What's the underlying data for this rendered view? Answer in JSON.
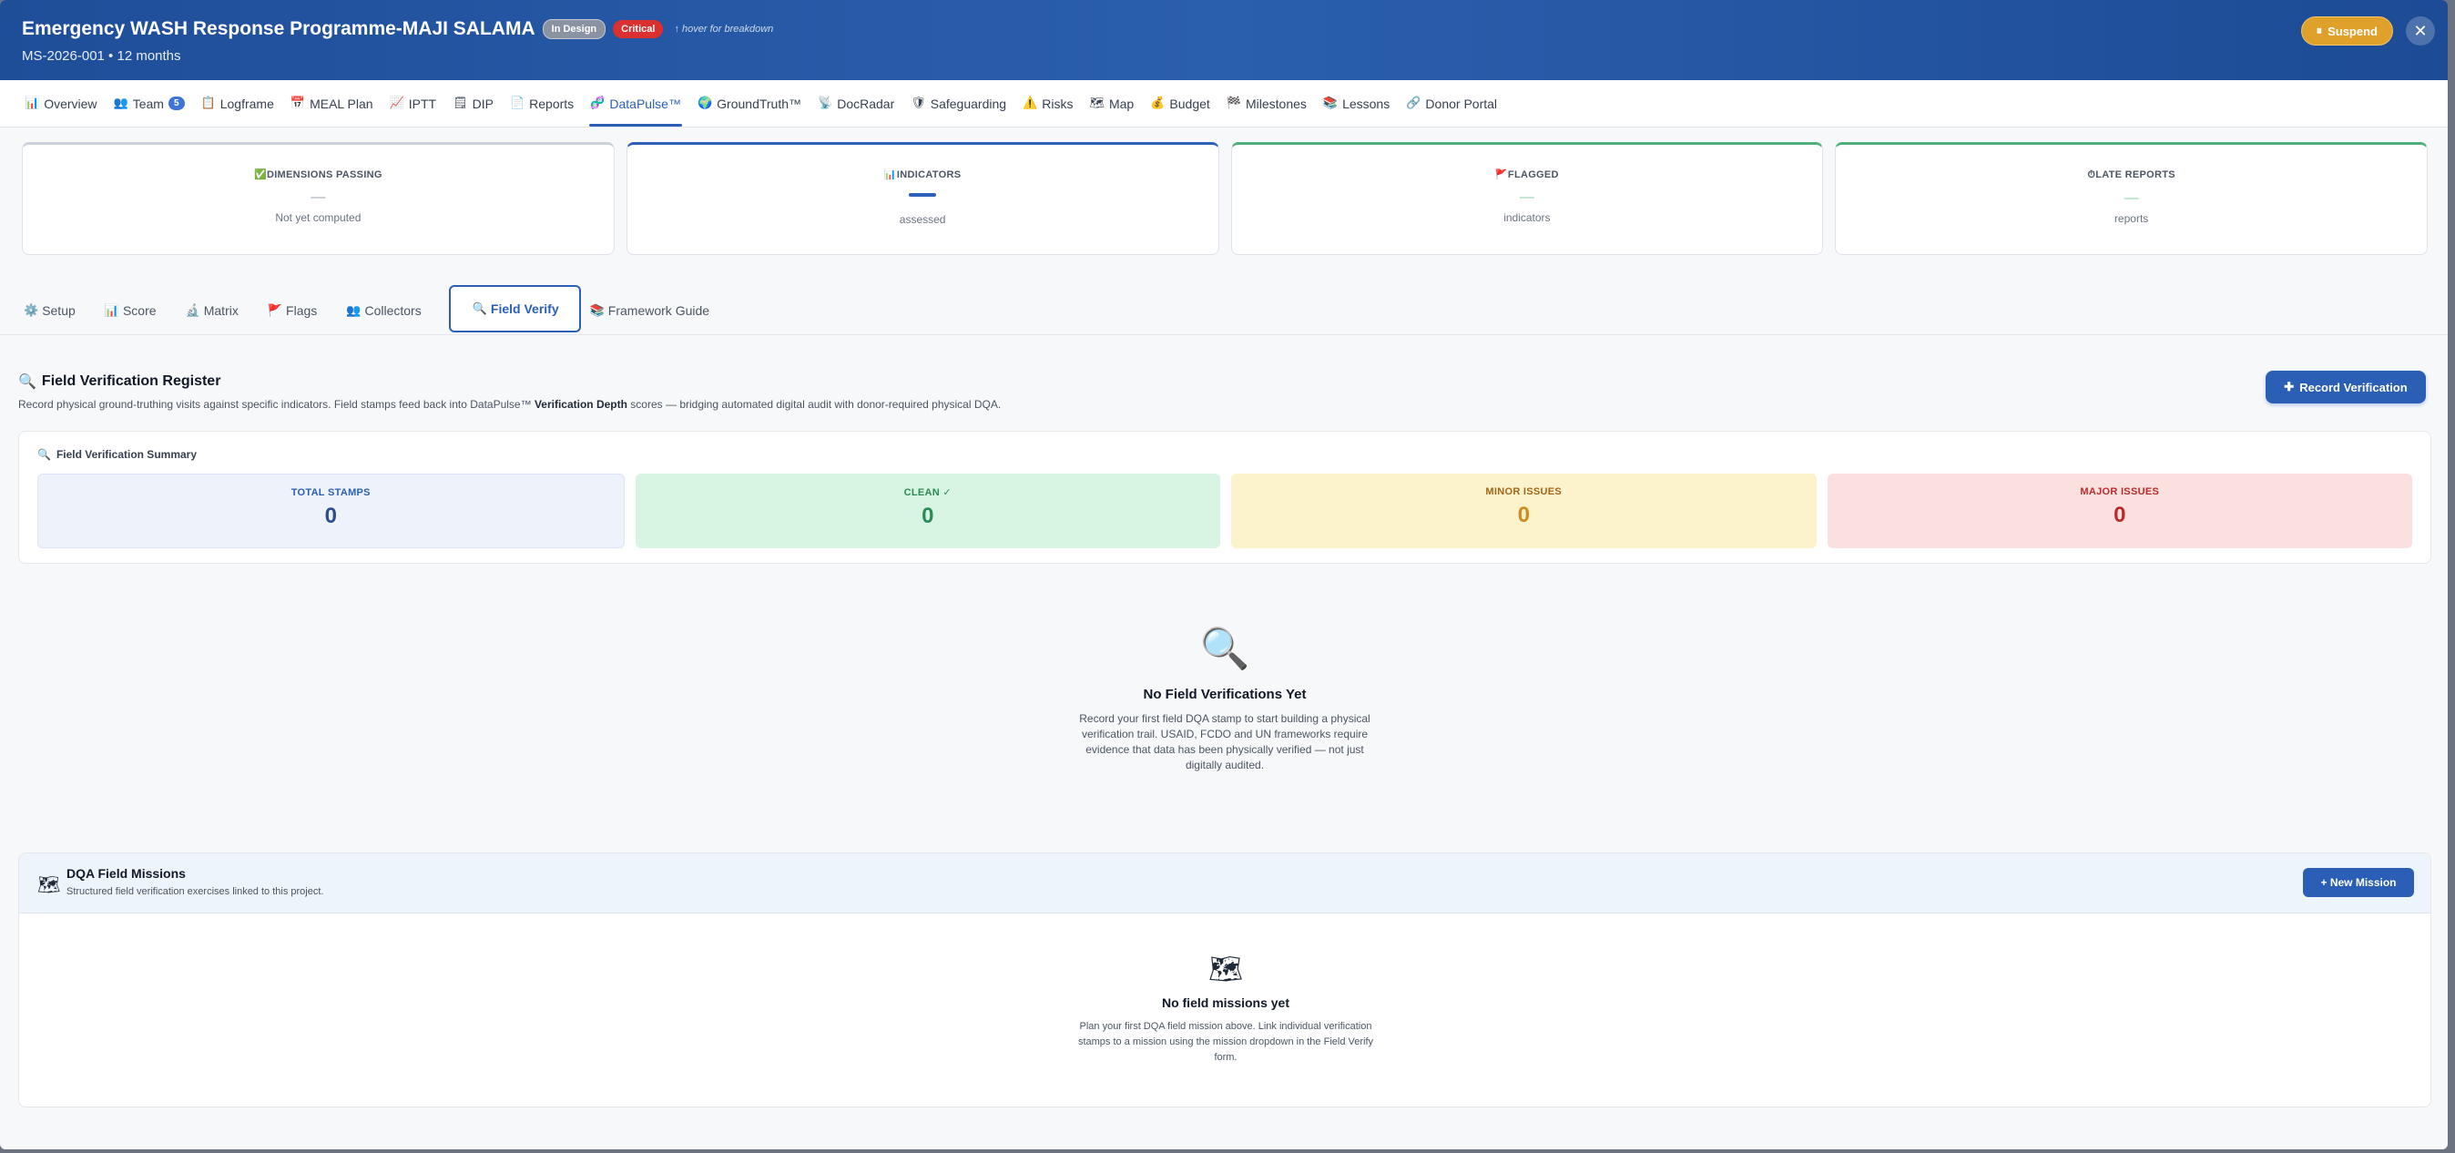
{
  "header": {
    "title": "Emergency WASH Response Programme-MAJI SALAMA",
    "badge_status": "In Design",
    "badge_priority": "Critical",
    "hint": "↑ hover for breakdown",
    "subtitle": "MS-2026-001 • 12 months",
    "suspend_label": "Suspend",
    "suspend_icon": "⏸",
    "close_icon": "✕"
  },
  "nav": [
    {
      "icon": "📊",
      "label": "Overview"
    },
    {
      "icon": "👥",
      "label": "Team",
      "count": "5"
    },
    {
      "icon": "📋",
      "label": "Logframe"
    },
    {
      "icon": "📅",
      "label": "MEAL Plan"
    },
    {
      "icon": "📈",
      "label": "IPTT"
    },
    {
      "icon": "🗒",
      "label": "DIP"
    },
    {
      "icon": "📄",
      "label": "Reports"
    },
    {
      "icon": "🧬",
      "label": "DataPulse™"
    },
    {
      "icon": "🌍",
      "label": "GroundTruth™"
    },
    {
      "icon": "📡",
      "label": "DocRadar"
    },
    {
      "icon": "🛡",
      "label": "Safeguarding"
    },
    {
      "icon": "⚠️",
      "label": "Risks"
    },
    {
      "icon": "🗺",
      "label": "Map"
    },
    {
      "icon": "💰",
      "label": "Budget"
    },
    {
      "icon": "🏁",
      "label": "Milestones"
    },
    {
      "icon": "📚",
      "label": "Lessons"
    },
    {
      "icon": "🔗",
      "label": "Donor Portal"
    }
  ],
  "kpis": [
    {
      "icon": "✅",
      "label": "DIMENSIONS PASSING",
      "value": "—",
      "sub": "Not yet computed"
    },
    {
      "icon": "📊",
      "label": "INDICATORS",
      "value": "",
      "sub": "assessed"
    },
    {
      "icon": "🚩",
      "label": "FLAGGED",
      "value": "—",
      "sub": "indicators"
    },
    {
      "icon": "⏱",
      "label": "LATE REPORTS",
      "value": "—",
      "sub": "reports"
    }
  ],
  "subtabs": [
    {
      "icon": "⚙️",
      "label": "Setup"
    },
    {
      "icon": "📊",
      "label": "Score"
    },
    {
      "icon": "🔬",
      "label": "Matrix"
    },
    {
      "icon": "🚩",
      "label": "Flags"
    },
    {
      "icon": "👥",
      "label": "Collectors"
    },
    {
      "icon": "🔍",
      "label": "Field Verify"
    },
    {
      "icon": "📚",
      "label": "Framework Guide"
    }
  ],
  "register": {
    "icon": "🔍",
    "title": "Field Verification Register",
    "desc_before": "Record physical ground-truthing visits against specific indicators. Field stamps feed back into DataPulse™ ",
    "desc_bold": "Verification Depth",
    "desc_after": " scores — bridging automated digital audit with donor-required physical DQA.",
    "record_label": "Record Verification",
    "record_icon": "✚"
  },
  "summary": {
    "icon": "🔍",
    "title": "Field Verification Summary",
    "stats": [
      {
        "label": "TOTAL STAMPS",
        "value": "0"
      },
      {
        "label": "CLEAN ✓",
        "value": "0"
      },
      {
        "label": "MINOR ISSUES",
        "value": "0"
      },
      {
        "label": "MAJOR ISSUES",
        "value": "0"
      }
    ]
  },
  "empty_state": {
    "icon": "🔍",
    "title": "No Field Verifications Yet",
    "text": "Record your first field DQA stamp to start building a physical verification trail. USAID, FCDO and UN frameworks require evidence that data has been physically verified — not just digitally audited."
  },
  "missions": {
    "icon": "🗺",
    "title": "DQA Field Missions",
    "subtitle": "Structured field verification exercises linked to this project.",
    "button_label": "+ New Mission",
    "empty_icon": "🗺",
    "empty_title": "No field missions yet",
    "empty_text": "Plan your first DQA field mission above. Link individual verification stamps to a mission using the mission dropdown in the Field Verify form."
  }
}
